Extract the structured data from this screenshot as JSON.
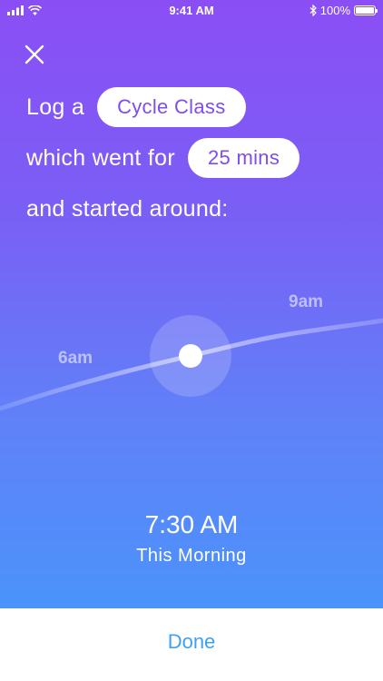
{
  "status_bar": {
    "time": "9:41 AM",
    "battery": "100%",
    "icons": [
      "signal-icon",
      "wifi-icon",
      "bluetooth-icon",
      "battery-icon"
    ]
  },
  "sentence": {
    "part1": "Log a",
    "activity": "Cycle Class",
    "part2": "which went for",
    "duration": "25 mins",
    "part3": "and started around:"
  },
  "timeline": {
    "start_label": "6am",
    "end_label": "9am"
  },
  "selected_time": {
    "time": "7:30 AM",
    "description": "This Morning"
  },
  "footer": {
    "done_label": "Done"
  },
  "colors": {
    "gradient_top": "#8b4ef5",
    "gradient_bottom": "#4b93fb",
    "pill_text": "#7d4df2",
    "done_text": "#3ea0f0"
  }
}
